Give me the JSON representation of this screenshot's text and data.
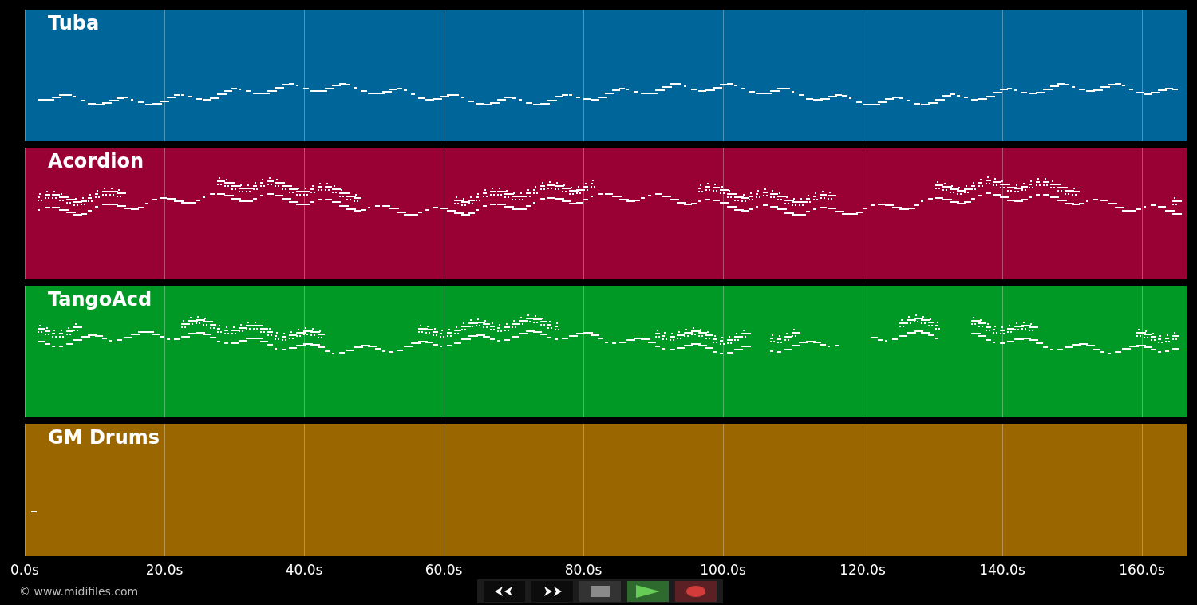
{
  "tracks": [
    {
      "name": "Tuba",
      "color": "#006699",
      "kind": "melodic"
    },
    {
      "name": "Acordion",
      "color": "#990033",
      "kind": "chords"
    },
    {
      "name": "TangoAcd",
      "color": "#009926",
      "kind": "chords"
    },
    {
      "name": "GM Drums",
      "color": "#996600",
      "kind": "drums"
    }
  ],
  "time_axis": [
    "0.0s",
    "20.0s",
    "40.0s",
    "60.0s",
    "80.0s",
    "100.0s",
    "120.0s",
    "140.0s",
    "160.0s"
  ],
  "copyright": "© www.midifiles.com",
  "transport": [
    {
      "kind": "rewind"
    },
    {
      "kind": "forward"
    },
    {
      "kind": "stop"
    },
    {
      "kind": "play"
    },
    {
      "kind": "record"
    }
  ]
}
